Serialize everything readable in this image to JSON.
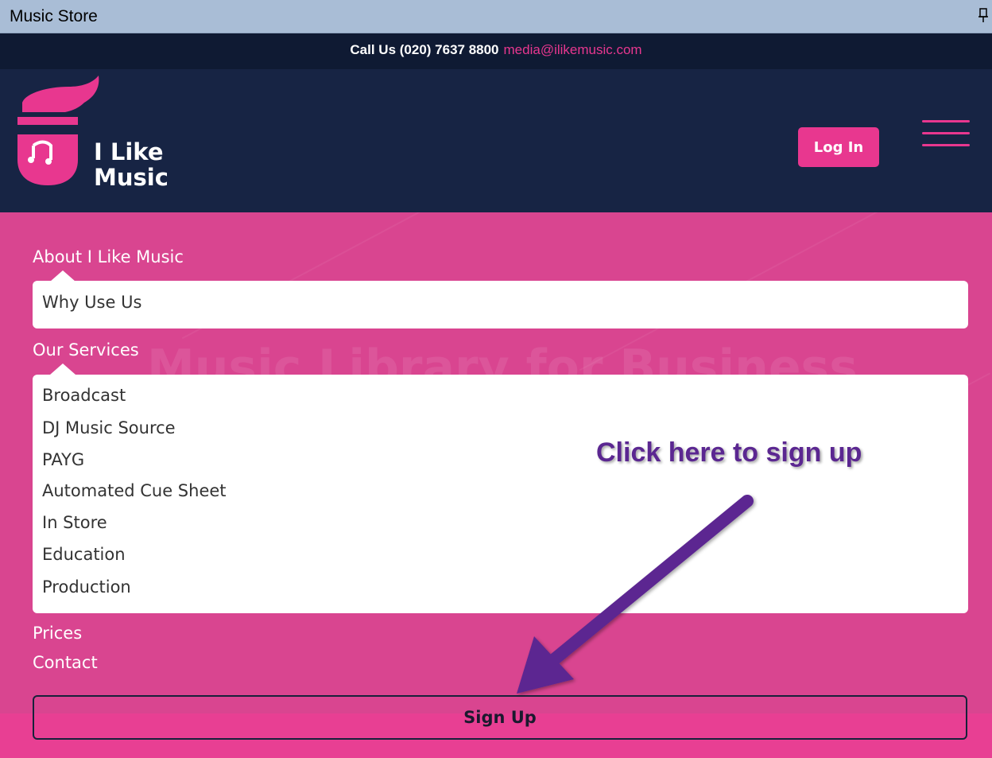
{
  "window": {
    "title": "Music Store"
  },
  "contact_bar": {
    "call_text": "Call Us (020) 7637 8800",
    "email": "media@ilikemusic.com"
  },
  "header": {
    "logo_line1": "I Like",
    "logo_line2": "Music",
    "login_label": "Log In"
  },
  "menu": {
    "background_heading": "Music Library for Business",
    "about_label": "About I Like Music",
    "about_items": [
      "Why Use Us"
    ],
    "services_label": "Our Services",
    "services_items": [
      "Broadcast",
      "DJ Music Source",
      "PAYG",
      "Automated Cue Sheet",
      "In Store",
      "Education",
      "Production"
    ],
    "prices_label": "Prices",
    "contact_label": "Contact",
    "signup_label": "Sign Up"
  },
  "annotation": {
    "text": "Click here to sign up",
    "color": "#5b2791"
  },
  "colors": {
    "brand_pink": "#e8378f",
    "navy": "#172444",
    "dark_navy": "#0f1a33",
    "menu_pink": "#d94590"
  },
  "icons": {
    "pin": "pin-icon",
    "hamburger": "hamburger-menu-icon",
    "logo": "i-like-music-logo-icon"
  }
}
